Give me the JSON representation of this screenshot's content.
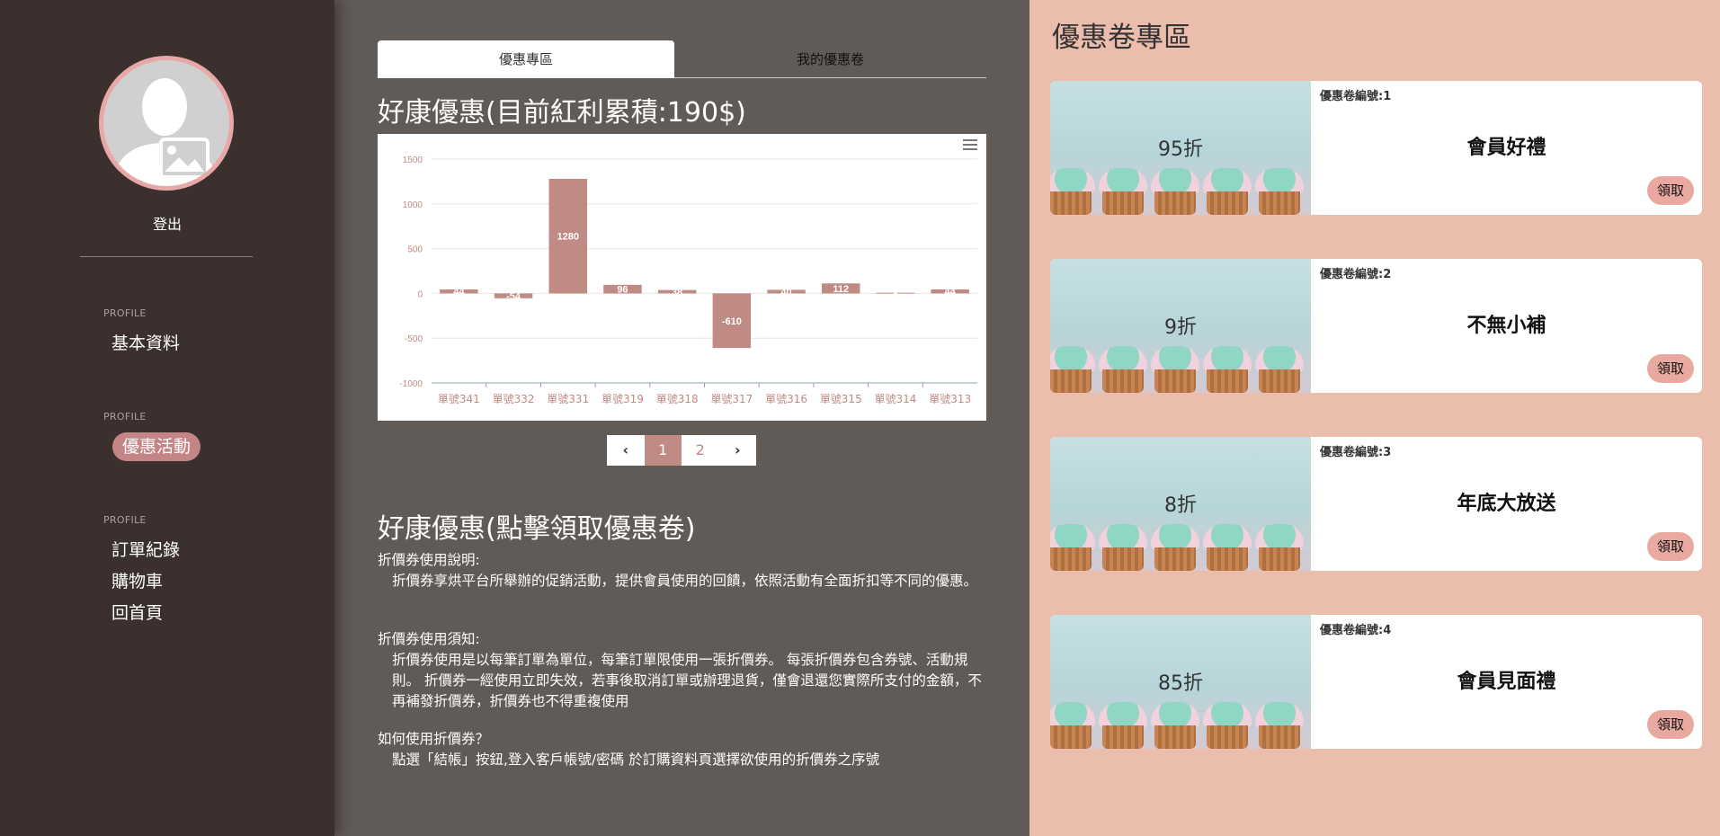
{
  "sidebar": {
    "logout_label": "登出",
    "sections": [
      {
        "label": "PROFILE",
        "items": [
          "基本資料"
        ]
      },
      {
        "label": "PROFILE",
        "items": [
          "優惠活動"
        ]
      },
      {
        "label": "PROFILE",
        "items": [
          "訂單紀錄",
          "購物車",
          "回首頁"
        ]
      }
    ],
    "active_item": "優惠活動"
  },
  "tabs": [
    {
      "label": "優惠專區",
      "active": true
    },
    {
      "label": "我的優惠卷",
      "active": false
    }
  ],
  "bonus_title": "好康優惠(目前紅利累積:190$)",
  "chart_data": {
    "type": "bar",
    "categories": [
      "單號341",
      "單號332",
      "單號331",
      "單號319",
      "單號318",
      "單號317",
      "單號316",
      "單號315",
      "單號314",
      "單號313"
    ],
    "values": [
      44,
      -54,
      1280,
      96,
      38,
      -610,
      40,
      112,
      8,
      44
    ],
    "ylim": [
      -1000,
      1500
    ],
    "yticks": [
      1500,
      1000,
      500,
      0,
      -500,
      -1000
    ],
    "grid": true,
    "bar_color": "#c08a85"
  },
  "pager": {
    "prev": "‹",
    "pages": [
      "1",
      "2"
    ],
    "active": "1",
    "next": "›"
  },
  "coupon_title": "好康優惠(點擊領取優惠卷)",
  "instructions": [
    {
      "heading": "折價券使用說明:",
      "body": "折價券享烘平台所舉辦的促銷活動，提供會員使用的回饋，依照活動有全面折扣等不同的優惠。"
    },
    {
      "heading": "折價券使用須知:",
      "body": "折價券使用是以每筆訂單為單位，每筆訂單限使用一張折價券。 每張折價券包含券號、活動規則。 折價券一經使用立即失效，若事後取消訂單或辦理退貨，僅會退還您實際所支付的金額，不再補發折價券，折價券也不得重複使用"
    },
    {
      "heading": "如何使用折價券？",
      "body": "點選「結帳」按鈕,登入客戶帳號/密碼 於訂購資料頁選擇欲使用的折價券之序號"
    }
  ],
  "coupon_panel": {
    "title": "優惠卷專區",
    "cards": [
      {
        "number_label": "優惠卷編號:1",
        "discount": "95折",
        "name": "會員好禮",
        "button": "領取"
      },
      {
        "number_label": "優惠卷編號:2",
        "discount": "9折",
        "name": "不無小補",
        "button": "領取"
      },
      {
        "number_label": "優惠卷編號:3",
        "discount": "8折",
        "name": "年底大放送",
        "button": "領取"
      },
      {
        "number_label": "優惠卷編號:4",
        "discount": "85折",
        "name": "會員見面禮",
        "button": "領取"
      }
    ]
  }
}
